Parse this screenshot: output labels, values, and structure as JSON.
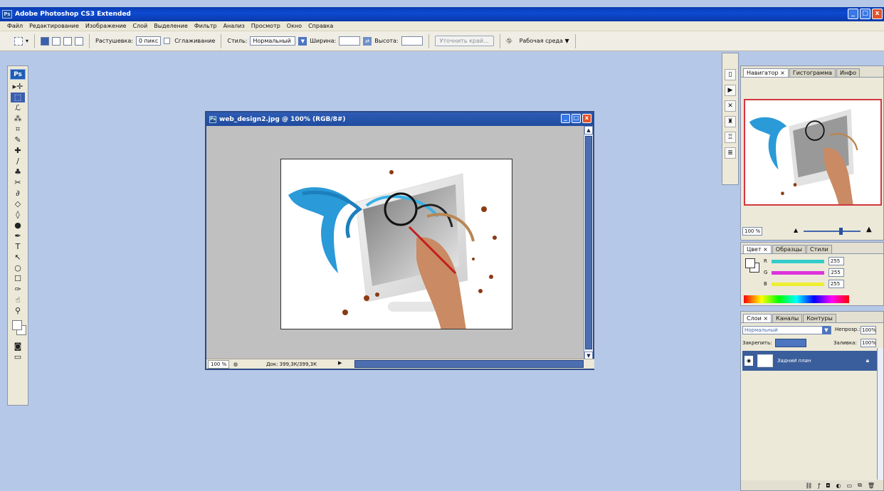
{
  "app": {
    "title": "Adobe Photoshop CS3 Extended",
    "logo": "Ps"
  },
  "window_controls": {
    "minimize": "_",
    "maximize": "□",
    "close": "x"
  },
  "menu": [
    "Файл",
    "Редактирование",
    "Изображение",
    "Слой",
    "Выделение",
    "Фильтр",
    "Анализ",
    "Просмотр",
    "Окно",
    "Справка"
  ],
  "options": {
    "feather_label": "Растушевка:",
    "feather_value": "0 пикс",
    "antialias_label": "Сглаживание",
    "style_label": "Стиль:",
    "style_value": "Нормальный",
    "width_label": "Ширина:",
    "height_label": "Высота:",
    "refine_edge": "Уточнить край...",
    "workspace": "Рабочая среда ▼"
  },
  "toolbox": {
    "logo": "Ps",
    "tools": [
      "▸✛",
      "⬚",
      "ℒ",
      "⁂",
      "⌗",
      "✎",
      "✚",
      "∕",
      "♣",
      "✂",
      "∂",
      "◇",
      "◊",
      "●",
      "✒",
      "T",
      "↖",
      "○",
      "☐",
      "✑",
      "☝",
      "⚲"
    ]
  },
  "document": {
    "title": "web_design2.jpg @ 100% (RGB/8#)",
    "zoom": "100 %",
    "info": "Док: 399,3К/399,3К"
  },
  "navigator": {
    "tabs": [
      "Навигатор ×",
      "Гистограмма",
      "Инфо"
    ],
    "zoom": "100 %"
  },
  "color_panel": {
    "tabs": [
      "Цвет ×",
      "Образцы",
      "Стили"
    ],
    "channels": [
      {
        "name": "R",
        "value": "255",
        "color": "#33cccc"
      },
      {
        "name": "G",
        "value": "255",
        "color": "#dd33dd"
      },
      {
        "name": "B",
        "value": "255",
        "color": "#eeee33"
      }
    ]
  },
  "layers_panel": {
    "tabs": [
      "Слои ×",
      "Каналы",
      "Контуры"
    ],
    "blend_mode": "Нормальный",
    "opacity_label": "Непрозр.:",
    "opacity": "100%",
    "lock_label": "Закрепить:",
    "fill_label": "Заливка:",
    "fill": "100%",
    "layers": [
      {
        "name": "Задний план"
      }
    ]
  },
  "colors": {
    "accent": "#0a3cb0",
    "workspace_bg": "#b6c8e8",
    "selected_layer": "#3a5e9c"
  }
}
